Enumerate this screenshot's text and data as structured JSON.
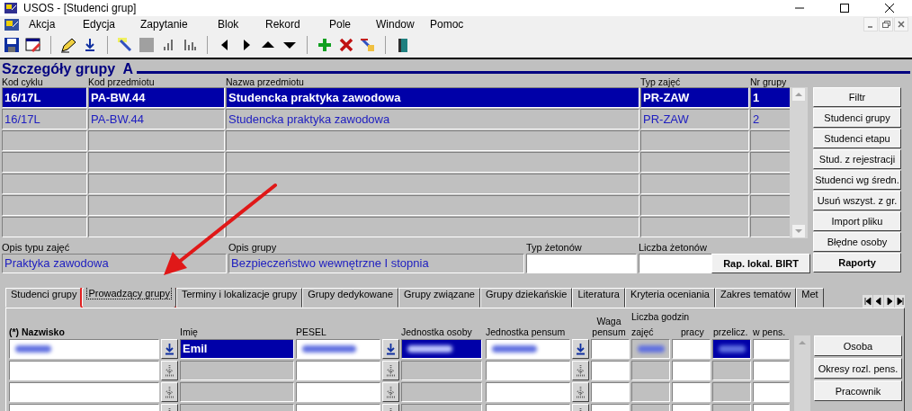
{
  "window": {
    "title": "USOS - [Studenci grup]"
  },
  "menu": [
    "Akcja",
    "Edycja",
    "Zapytanie",
    "Blok",
    "Rekord",
    "Pole",
    "Window",
    "Pomoc"
  ],
  "section_title": "Szczegóły grupy  A",
  "groups_table": {
    "columns": [
      "Kod cyklu",
      "Kod przedmiotu",
      "Nazwa przedmiotu",
      "Typ zajęć",
      "Nr grupy"
    ],
    "rows": [
      {
        "selected": true,
        "cells": [
          "16/17L",
          "PA-BW.44",
          "Studencka praktyka zawodowa",
          "PR-ZAW",
          "1"
        ]
      },
      {
        "selected": false,
        "cells": [
          "16/17L",
          "PA-BW.44",
          "Studencka praktyka zawodowa",
          "PR-ZAW",
          "2"
        ]
      }
    ]
  },
  "side_buttons": [
    {
      "label": "Filtr",
      "bold": false
    },
    {
      "label": "Studenci grupy",
      "bold": false
    },
    {
      "label": "Studenci etapu",
      "bold": false
    },
    {
      "label": "Stud. z rejestracji",
      "bold": false
    },
    {
      "label": "Studenci wg średn.",
      "bold": false
    },
    {
      "label": "Usuń wszyst. z gr.",
      "bold": false
    },
    {
      "label": "Import pliku",
      "bold": false
    },
    {
      "label": "Błędne osoby",
      "bold": false
    },
    {
      "label": "Raporty",
      "bold": true
    }
  ],
  "fields": [
    {
      "label": "Opis typu zajęć",
      "value": "Praktyka zawodowa"
    },
    {
      "label": "Opis grupy",
      "value": "Bezpieczeństwo wewnętrzne I stopnia"
    },
    {
      "label": "Typ żetonów"
    },
    {
      "label": "Liczba żetonów"
    }
  ],
  "report_button": "Rap. lokal. BIRT",
  "tabs": [
    {
      "label": "Studenci grupy",
      "selected": false,
      "highlighted": false
    },
    {
      "label": "Prowadzący grupy",
      "selected": true,
      "highlighted": true
    },
    {
      "label": "Terminy i lokalizacje grupy",
      "selected": false,
      "highlighted": false
    },
    {
      "label": "Grupy dedykowane",
      "selected": false,
      "highlighted": false
    },
    {
      "label": "Grupy związane",
      "selected": false,
      "highlighted": false
    },
    {
      "label": "Grupy dziekańskie",
      "selected": false,
      "highlighted": false
    },
    {
      "label": "Literatura",
      "selected": false,
      "highlighted": false
    },
    {
      "label": "Kryteria oceniania",
      "selected": false,
      "highlighted": false
    },
    {
      "label": "Zakres tematów",
      "selected": false,
      "highlighted": false
    },
    {
      "label": "Met",
      "selected": false,
      "highlighted": false
    }
  ],
  "staff_table": {
    "columns": [
      "(*) Nazwisko",
      "Imię",
      "PESEL",
      "Jednostka osoby",
      "Jednostka pensum",
      "Waga pensum",
      "zajęć",
      "pracy",
      "przelicz.",
      "w pens."
    ],
    "group_heading": "Liczba godzin",
    "rows": [
      {
        "selected": true,
        "blurred": true,
        "first_name": "Emil"
      },
      {
        "selected": false,
        "blurred": false
      },
      {
        "selected": false,
        "blurred": false
      },
      {
        "selected": false,
        "blurred": false
      }
    ]
  },
  "staff_buttons": [
    "Osoba",
    "Okresy rozl. pens.",
    "Pracownik"
  ]
}
